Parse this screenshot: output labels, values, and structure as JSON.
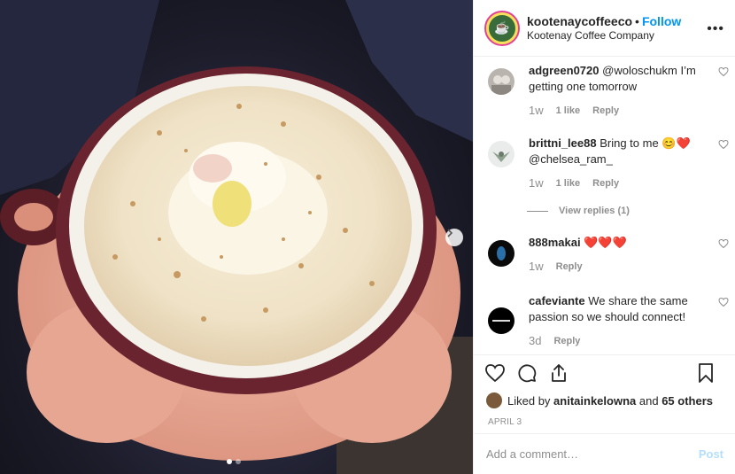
{
  "photo": {
    "description_icon": "coffee-photo"
  },
  "header": {
    "username": "kootenaycoffeeco",
    "separator": "•",
    "follow_label": "Follow",
    "subtitle": "Kootenay Coffee Company",
    "more_label": "•••"
  },
  "comments": [
    {
      "user": "adgreen0720",
      "text": "@woloschukm I’m getting one tomorrow",
      "time": "1w",
      "likes": "1 like",
      "reply": "Reply"
    },
    {
      "user": "brittni_lee88",
      "text": "Bring to me 😊❤️ @chelsea_ram_",
      "time": "1w",
      "likes": "1 like",
      "reply": "Reply"
    },
    {
      "user": "888makai",
      "text": "❤️❤️❤️",
      "time": "1w",
      "reply": "Reply"
    },
    {
      "user": "cafeviante",
      "text": "We share the same passion so we should connect!",
      "time": "3d",
      "reply": "Reply"
    }
  ],
  "view_replies": "View replies (1)",
  "likes": {
    "prefix": "Liked by ",
    "user": "anitainkelowna",
    "middle": " and ",
    "others": "65 others"
  },
  "date": "APRIL 3",
  "add_comment": {
    "placeholder": "Add a comment…",
    "post_label": "Post"
  },
  "colors": {
    "accent": "#0095f6",
    "post_disabled": "#b2dffc"
  }
}
